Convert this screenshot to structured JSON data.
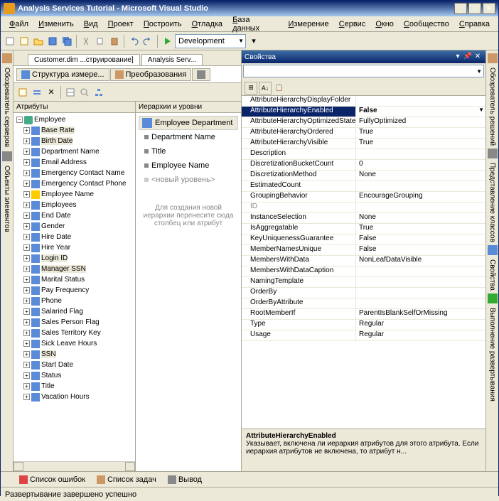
{
  "window": {
    "title": "Analysis Services Tutorial - Microsoft Visual Studio"
  },
  "menu": [
    "Файл",
    "Изменить",
    "Вид",
    "Проект",
    "Построить",
    "Отладка",
    "База данных",
    "Измерение",
    "Сервис",
    "Окно",
    "Сообщество",
    "Справка"
  ],
  "toolbar": {
    "config": "Development"
  },
  "leftstrip": [
    "Обозреватель серверов",
    "Объекты элементов"
  ],
  "rightstrip": [
    "Обозреватель решений",
    "Представление классов",
    "Свойства",
    "Выполнение развертывания"
  ],
  "doctabs": [
    "Customer.dim ...струирование]",
    "Analysis Serv..."
  ],
  "subtabs": [
    "Структура измере...",
    "Преобразования"
  ],
  "pane1": {
    "header": "Атрибуты",
    "root": "Employee",
    "items": [
      {
        "l": "Base Rate",
        "hl": true
      },
      {
        "l": "Birth Date",
        "hl": true
      },
      {
        "l": "Department Name"
      },
      {
        "l": "Email Address"
      },
      {
        "l": "Emergency Contact Name"
      },
      {
        "l": "Emergency Contact Phone"
      },
      {
        "l": "Employee Name",
        "warn": true
      },
      {
        "l": "Employees"
      },
      {
        "l": "End Date"
      },
      {
        "l": "Gender"
      },
      {
        "l": "Hire Date"
      },
      {
        "l": "Hire Year"
      },
      {
        "l": "Login ID",
        "hl": true
      },
      {
        "l": "Manager SSN",
        "hl": true
      },
      {
        "l": "Marital Status"
      },
      {
        "l": "Pay Frequency"
      },
      {
        "l": "Phone"
      },
      {
        "l": "Salaried Flag"
      },
      {
        "l": "Sales Person Flag"
      },
      {
        "l": "Sales Territory Key"
      },
      {
        "l": "Sick Leave Hours"
      },
      {
        "l": "SSN",
        "hl": true
      },
      {
        "l": "Start Date"
      },
      {
        "l": "Status"
      },
      {
        "l": "Title"
      },
      {
        "l": "Vacation Hours"
      }
    ]
  },
  "pane2": {
    "header": "Иерархии и уровни",
    "group": "Employee Department",
    "levels": [
      "Department Name",
      "Title",
      "Employee Name"
    ],
    "newlevel": "<новый уровень>",
    "hint": "Для создания новой иерархии перенесите сюда столбец или атрибут"
  },
  "props": {
    "title": "Свойства",
    "rows": [
      {
        "n": "AttributeHierarchyDisplayFolder",
        "v": ""
      },
      {
        "n": "AttributeHierarchyEnabled",
        "v": "False",
        "sel": true
      },
      {
        "n": "AttributeHierarchyOptimizedState",
        "v": "FullyOptimized"
      },
      {
        "n": "AttributeHierarchyOrdered",
        "v": "True"
      },
      {
        "n": "AttributeHierarchyVisible",
        "v": "True"
      },
      {
        "n": "Description",
        "v": ""
      },
      {
        "n": "DiscretizationBucketCount",
        "v": "0"
      },
      {
        "n": "DiscretizationMethod",
        "v": "None"
      },
      {
        "n": "EstimatedCount",
        "v": ""
      },
      {
        "n": "GroupingBehavior",
        "v": "EncourageGrouping"
      },
      {
        "n": "ID",
        "v": "",
        "dim": true
      },
      {
        "n": "InstanceSelection",
        "v": "None"
      },
      {
        "n": "IsAggregatable",
        "v": "True"
      },
      {
        "n": "KeyUniquenessGuarantee",
        "v": "False"
      },
      {
        "n": "MemberNamesUnique",
        "v": "False"
      },
      {
        "n": "MembersWithData",
        "v": "NonLeafDataVisible"
      },
      {
        "n": "MembersWithDataCaption",
        "v": ""
      },
      {
        "n": "NamingTemplate",
        "v": ""
      },
      {
        "n": "OrderBy",
        "v": ""
      },
      {
        "n": "OrderByAttribute",
        "v": ""
      },
      {
        "n": "RootMemberIf",
        "v": "ParentIsBlankSelfOrMissing"
      },
      {
        "n": "Type",
        "v": "Regular"
      },
      {
        "n": "Usage",
        "v": "Regular"
      }
    ],
    "desc": {
      "name": "AttributeHierarchyEnabled",
      "text": "Указывает, включена ли иерархия атрибутов для этого атрибута. Если иерархия атрибутов не включена, то атрибут н..."
    }
  },
  "bottomtabs": [
    "Список ошибок",
    "Список задач",
    "Вывод"
  ],
  "status": "Развертывание завершено успешно"
}
